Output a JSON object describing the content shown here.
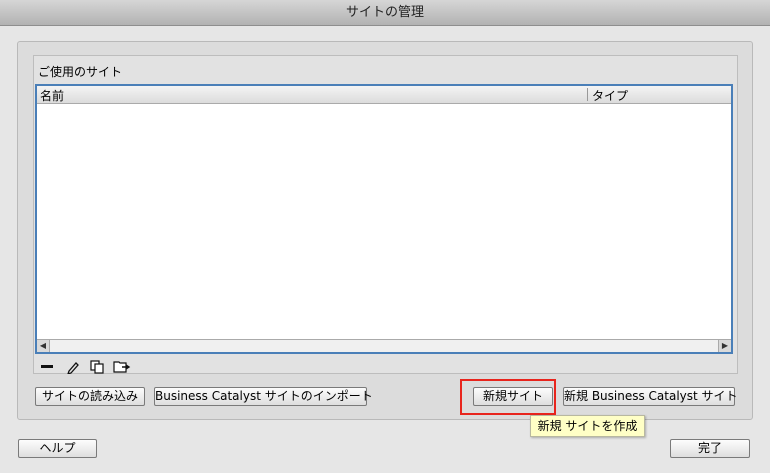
{
  "window": {
    "title": "サイトの管理"
  },
  "sites_group": {
    "label": "ご使用のサイト",
    "columns": [
      "名前",
      "タイプ"
    ],
    "rows": []
  },
  "toolbar": {
    "icons": [
      "minus-icon",
      "pencil-icon",
      "duplicate-icon",
      "export-icon"
    ]
  },
  "buttons": {
    "import_sites": "サイトの読み込み",
    "import_bc": "Business Catalyst サイトのインポート",
    "new_site": "新規サイト",
    "new_bc_site": "新規 Business Catalyst サイト",
    "help": "ヘルプ",
    "done": "完了"
  },
  "tooltip": {
    "text": "新規 サイトを作成"
  },
  "colors": {
    "highlight": "#e8251d",
    "tooltip_bg": "#ffffc6",
    "list_focus": "#4a7fb8"
  }
}
